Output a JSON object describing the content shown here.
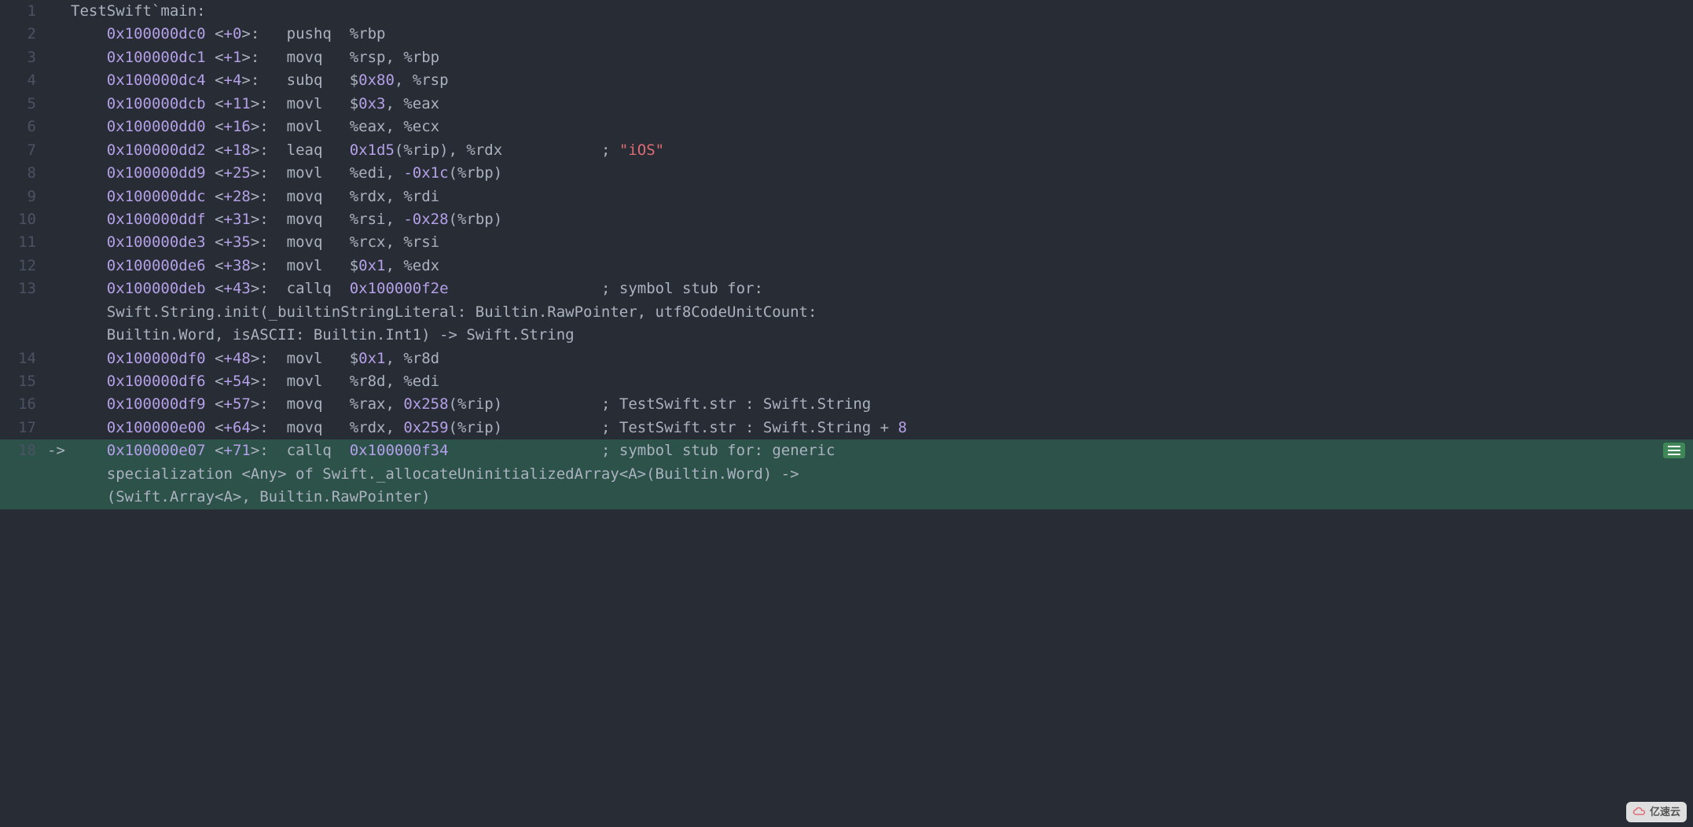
{
  "header": "TestSwift`main:",
  "lines": [
    {
      "n": 1,
      "arrow": "",
      "indent": 0,
      "tokens": [
        {
          "c": "plain",
          "t": "TestSwift`main:"
        }
      ]
    },
    {
      "n": 2,
      "arrow": "",
      "indent": 1,
      "addr": "0x100000dc0",
      "off": "<+0>",
      "mnem": "pushq",
      "args": [
        {
          "c": "plain",
          "t": "%rbp"
        }
      ]
    },
    {
      "n": 3,
      "arrow": "",
      "indent": 1,
      "addr": "0x100000dc1",
      "off": "<+1>",
      "mnem": "movq",
      "args": [
        {
          "c": "plain",
          "t": "%rsp, %rbp"
        }
      ]
    },
    {
      "n": 4,
      "arrow": "",
      "indent": 1,
      "addr": "0x100000dc4",
      "off": "<+4>",
      "mnem": "subq",
      "args": [
        {
          "c": "plain",
          "t": "$"
        },
        {
          "c": "num",
          "t": "0x80"
        },
        {
          "c": "plain",
          "t": ", %rsp"
        }
      ]
    },
    {
      "n": 5,
      "arrow": "",
      "indent": 1,
      "addr": "0x100000dcb",
      "off": "<+11>",
      "mnem": "movl",
      "args": [
        {
          "c": "plain",
          "t": "$"
        },
        {
          "c": "num",
          "t": "0x3"
        },
        {
          "c": "plain",
          "t": ", %eax"
        }
      ]
    },
    {
      "n": 6,
      "arrow": "",
      "indent": 1,
      "addr": "0x100000dd0",
      "off": "<+16>",
      "mnem": "movl",
      "args": [
        {
          "c": "plain",
          "t": "%eax, %ecx"
        }
      ]
    },
    {
      "n": 7,
      "arrow": "",
      "indent": 1,
      "addr": "0x100000dd2",
      "off": "<+18>",
      "mnem": "leaq",
      "args": [
        {
          "c": "num",
          "t": "0x1d5"
        },
        {
          "c": "plain",
          "t": "(%rip), %rdx"
        }
      ],
      "comment": [
        {
          "c": "plain",
          "t": "; "
        },
        {
          "c": "str",
          "t": "\"iOS\""
        }
      ],
      "comment_col": 59
    },
    {
      "n": 8,
      "arrow": "",
      "indent": 1,
      "addr": "0x100000dd9",
      "off": "<+25>",
      "mnem": "movl",
      "args": [
        {
          "c": "plain",
          "t": "%edi, "
        },
        {
          "c": "num",
          "t": "-0x1c"
        },
        {
          "c": "plain",
          "t": "(%rbp)"
        }
      ]
    },
    {
      "n": 9,
      "arrow": "",
      "indent": 1,
      "addr": "0x100000ddc",
      "off": "<+28>",
      "mnem": "movq",
      "args": [
        {
          "c": "plain",
          "t": "%rdx, %rdi"
        }
      ]
    },
    {
      "n": 10,
      "arrow": "",
      "indent": 1,
      "addr": "0x100000ddf",
      "off": "<+31>",
      "mnem": "movq",
      "args": [
        {
          "c": "plain",
          "t": "%rsi, "
        },
        {
          "c": "num",
          "t": "-0x28"
        },
        {
          "c": "plain",
          "t": "(%rbp)"
        }
      ]
    },
    {
      "n": 11,
      "arrow": "",
      "indent": 1,
      "addr": "0x100000de3",
      "off": "<+35>",
      "mnem": "movq",
      "args": [
        {
          "c": "plain",
          "t": "%rcx, %rsi"
        }
      ]
    },
    {
      "n": 12,
      "arrow": "",
      "indent": 1,
      "addr": "0x100000de6",
      "off": "<+38>",
      "mnem": "movl",
      "args": [
        {
          "c": "plain",
          "t": "$"
        },
        {
          "c": "num",
          "t": "0x1"
        },
        {
          "c": "plain",
          "t": ", %edx"
        }
      ]
    },
    {
      "n": 13,
      "arrow": "",
      "indent": 1,
      "addr": "0x100000deb",
      "off": "<+43>",
      "mnem": "callq",
      "args": [
        {
          "c": "num",
          "t": "0x100000f2e"
        }
      ],
      "comment": [
        {
          "c": "plain",
          "t": "; symbol stub for: Swift.String.init(_builtinStringLiteral: Builtin.RawPointer, utf8CodeUnitCount: Builtin.Word, isASCII: Builtin.Int1) -> Swift.String"
        }
      ],
      "comment_col": 59,
      "wrap": [
        "Swift.String.init(_builtinStringLiteral: Builtin.RawPointer, utf8CodeUnitCount: ",
        "Builtin.Word, isASCII: Builtin.Int1) -> Swift.String"
      ],
      "comment_inline_first": "; symbol stub for: "
    },
    {
      "n": 14,
      "arrow": "",
      "indent": 1,
      "addr": "0x100000df0",
      "off": "<+48>",
      "mnem": "movl",
      "args": [
        {
          "c": "plain",
          "t": "$"
        },
        {
          "c": "num",
          "t": "0x1"
        },
        {
          "c": "plain",
          "t": ", %r8d"
        }
      ]
    },
    {
      "n": 15,
      "arrow": "",
      "indent": 1,
      "addr": "0x100000df6",
      "off": "<+54>",
      "mnem": "movl",
      "args": [
        {
          "c": "plain",
          "t": "%r8d, %edi"
        }
      ]
    },
    {
      "n": 16,
      "arrow": "",
      "indent": 1,
      "addr": "0x100000df9",
      "off": "<+57>",
      "mnem": "movq",
      "args": [
        {
          "c": "plain",
          "t": "%rax, "
        },
        {
          "c": "num",
          "t": "0x258"
        },
        {
          "c": "plain",
          "t": "(%rip)"
        }
      ],
      "comment": [
        {
          "c": "plain",
          "t": "; TestSwift.str : Swift.String"
        }
      ],
      "comment_col": 59
    },
    {
      "n": 17,
      "arrow": "",
      "indent": 1,
      "addr": "0x100000e00",
      "off": "<+64>",
      "mnem": "movq",
      "args": [
        {
          "c": "plain",
          "t": "%rdx, "
        },
        {
          "c": "num",
          "t": "0x259"
        },
        {
          "c": "plain",
          "t": "(%rip)"
        }
      ],
      "comment": [
        {
          "c": "plain",
          "t": "; TestSwift.str : Swift.String + "
        },
        {
          "c": "num",
          "t": "8"
        }
      ],
      "comment_col": 59
    },
    {
      "n": 18,
      "arrow": "->",
      "hl": true,
      "indent": 1,
      "addr": "0x100000e07",
      "off": "<+71>",
      "mnem": "callq",
      "args": [
        {
          "c": "num",
          "t": "0x100000f34"
        }
      ],
      "comment": [
        {
          "c": "plain",
          "t": "; symbol stub for: generic specialization <Any> of Swift._allocateUninitializedArray<A>(Builtin.Word) -> (Swift.Array<A>, Builtin.RawPointer)"
        }
      ],
      "comment_col": 59,
      "wrap_full": [
        "; symbol stub for: generic ",
        "specialization <Any> of Swift._allocateUninitializedArray<A>(Builtin.Word) -> ",
        "(Swift.Array<A>, Builtin.RawPointer)"
      ]
    }
  ],
  "logo": "亿速云"
}
